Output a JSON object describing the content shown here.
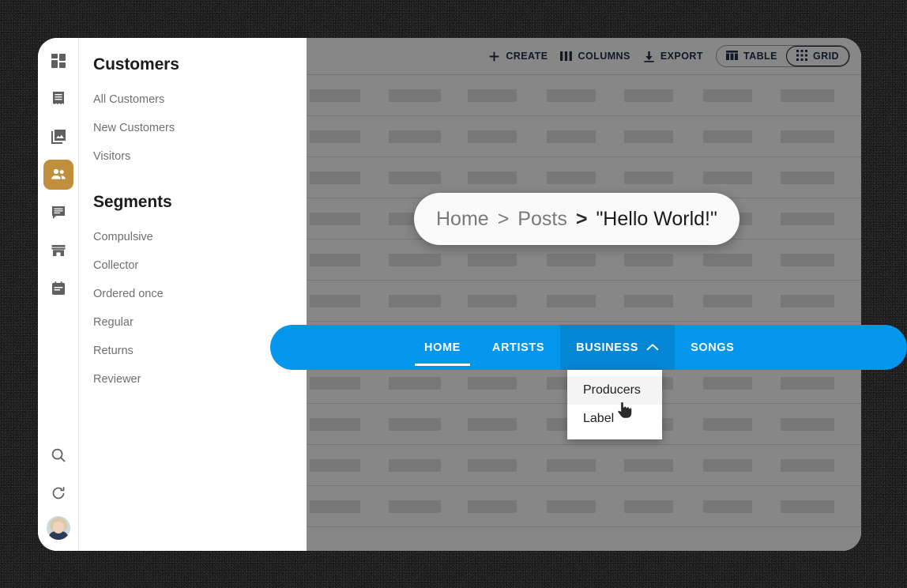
{
  "rail": {
    "items": [
      {
        "name": "dashboard",
        "icon": "dashboard-icon",
        "active": false
      },
      {
        "name": "orders",
        "icon": "receipt-icon",
        "active": false
      },
      {
        "name": "media",
        "icon": "photo-library-icon",
        "active": false
      },
      {
        "name": "customers",
        "icon": "people-icon",
        "active": true
      },
      {
        "name": "messages",
        "icon": "chat-icon",
        "active": false
      },
      {
        "name": "store",
        "icon": "store-icon",
        "active": false
      },
      {
        "name": "events",
        "icon": "calendar-icon",
        "active": false
      }
    ],
    "bottom": [
      {
        "name": "search",
        "icon": "search-icon"
      },
      {
        "name": "refresh",
        "icon": "refresh-icon"
      }
    ],
    "avatar_label": "User avatar",
    "active_color": "#c08f3c"
  },
  "sidebar": {
    "sections": [
      {
        "title": "Customers",
        "items": [
          "All Customers",
          "New Customers",
          "Visitors"
        ]
      },
      {
        "title": "Segments",
        "items": [
          "Compulsive",
          "Collector",
          "Ordered once",
          "Regular",
          "Returns",
          "Reviewer"
        ]
      }
    ]
  },
  "toolbar": {
    "create_label": "CREATE",
    "columns_label": "COLUMNS",
    "export_label": "EXPORT",
    "view_table_label": "TABLE",
    "view_grid_label": "GRID",
    "selected_view": "GRID"
  },
  "table": {
    "columns": 7,
    "rows": 11,
    "placeholder": true
  },
  "breadcrumb": {
    "items": [
      "Home",
      "Posts",
      "\"Hello World!\""
    ],
    "separator": ">",
    "current_index": 2
  },
  "navbar": {
    "accent": "#0296ec",
    "accent_open": "#0586d4",
    "tabs": [
      {
        "label": "HOME",
        "active": true,
        "open": false,
        "has_chevron": false
      },
      {
        "label": "ARTISTS",
        "active": false,
        "open": false,
        "has_chevron": false
      },
      {
        "label": "BUSINESS",
        "active": false,
        "open": true,
        "has_chevron": true,
        "chevron": "chevron-up-icon"
      },
      {
        "label": "SONGS",
        "active": false,
        "open": false,
        "has_chevron": false
      }
    ]
  },
  "dropdown": {
    "parent": "BUSINESS",
    "items": [
      {
        "label": "Producers",
        "hovered": true
      },
      {
        "label": "Label",
        "hovered": false
      }
    ]
  }
}
